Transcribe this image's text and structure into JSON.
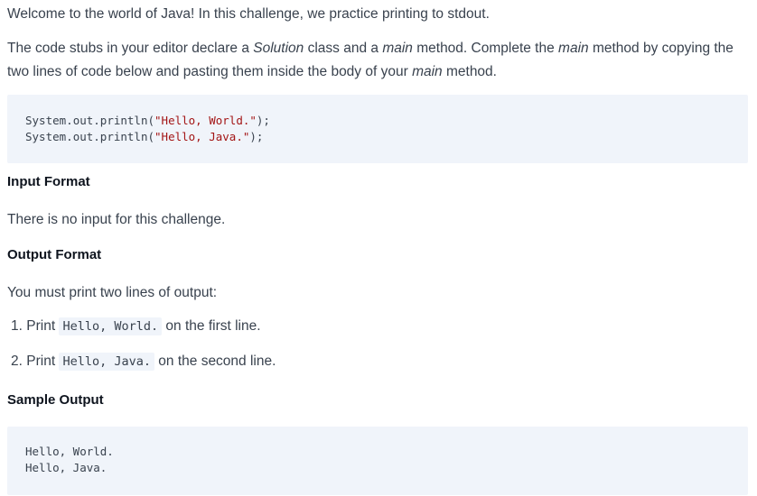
{
  "intro": {
    "welcome": "Welcome to the world of Java! In this challenge, we practice printing to stdout.",
    "stubs_parts": [
      "The code stubs in your editor declare a ",
      "Solution",
      " class and a ",
      "main",
      " method. Complete the ",
      "main",
      " method by copying the two lines of code below and pasting them inside the body of your ",
      "main",
      " method."
    ]
  },
  "code_snippet": {
    "lines": [
      {
        "obj": "System",
        "dot1": ".",
        "field": "out",
        "dot2": ".",
        "method": "println",
        "open": "(",
        "string": "\"Hello, World.\"",
        "close": ");"
      },
      {
        "obj": "System",
        "dot1": ".",
        "field": "out",
        "dot2": ".",
        "method": "println",
        "open": "(",
        "string": "\"Hello, Java.\"",
        "close": ");"
      }
    ]
  },
  "input_format": {
    "heading": "Input Format",
    "text": "There is no input for this challenge."
  },
  "output_format": {
    "heading": "Output Format",
    "text": "You must print two lines of output:",
    "items": [
      {
        "num": "1.",
        "pre": "Print ",
        "code": "Hello, World.",
        "post": " on the first line."
      },
      {
        "num": "2.",
        "pre": "Print ",
        "code": "Hello, Java.",
        "post": " on the second line."
      }
    ]
  },
  "sample_output": {
    "heading": "Sample Output",
    "lines": [
      "Hello, World.",
      "Hello, Java."
    ]
  }
}
